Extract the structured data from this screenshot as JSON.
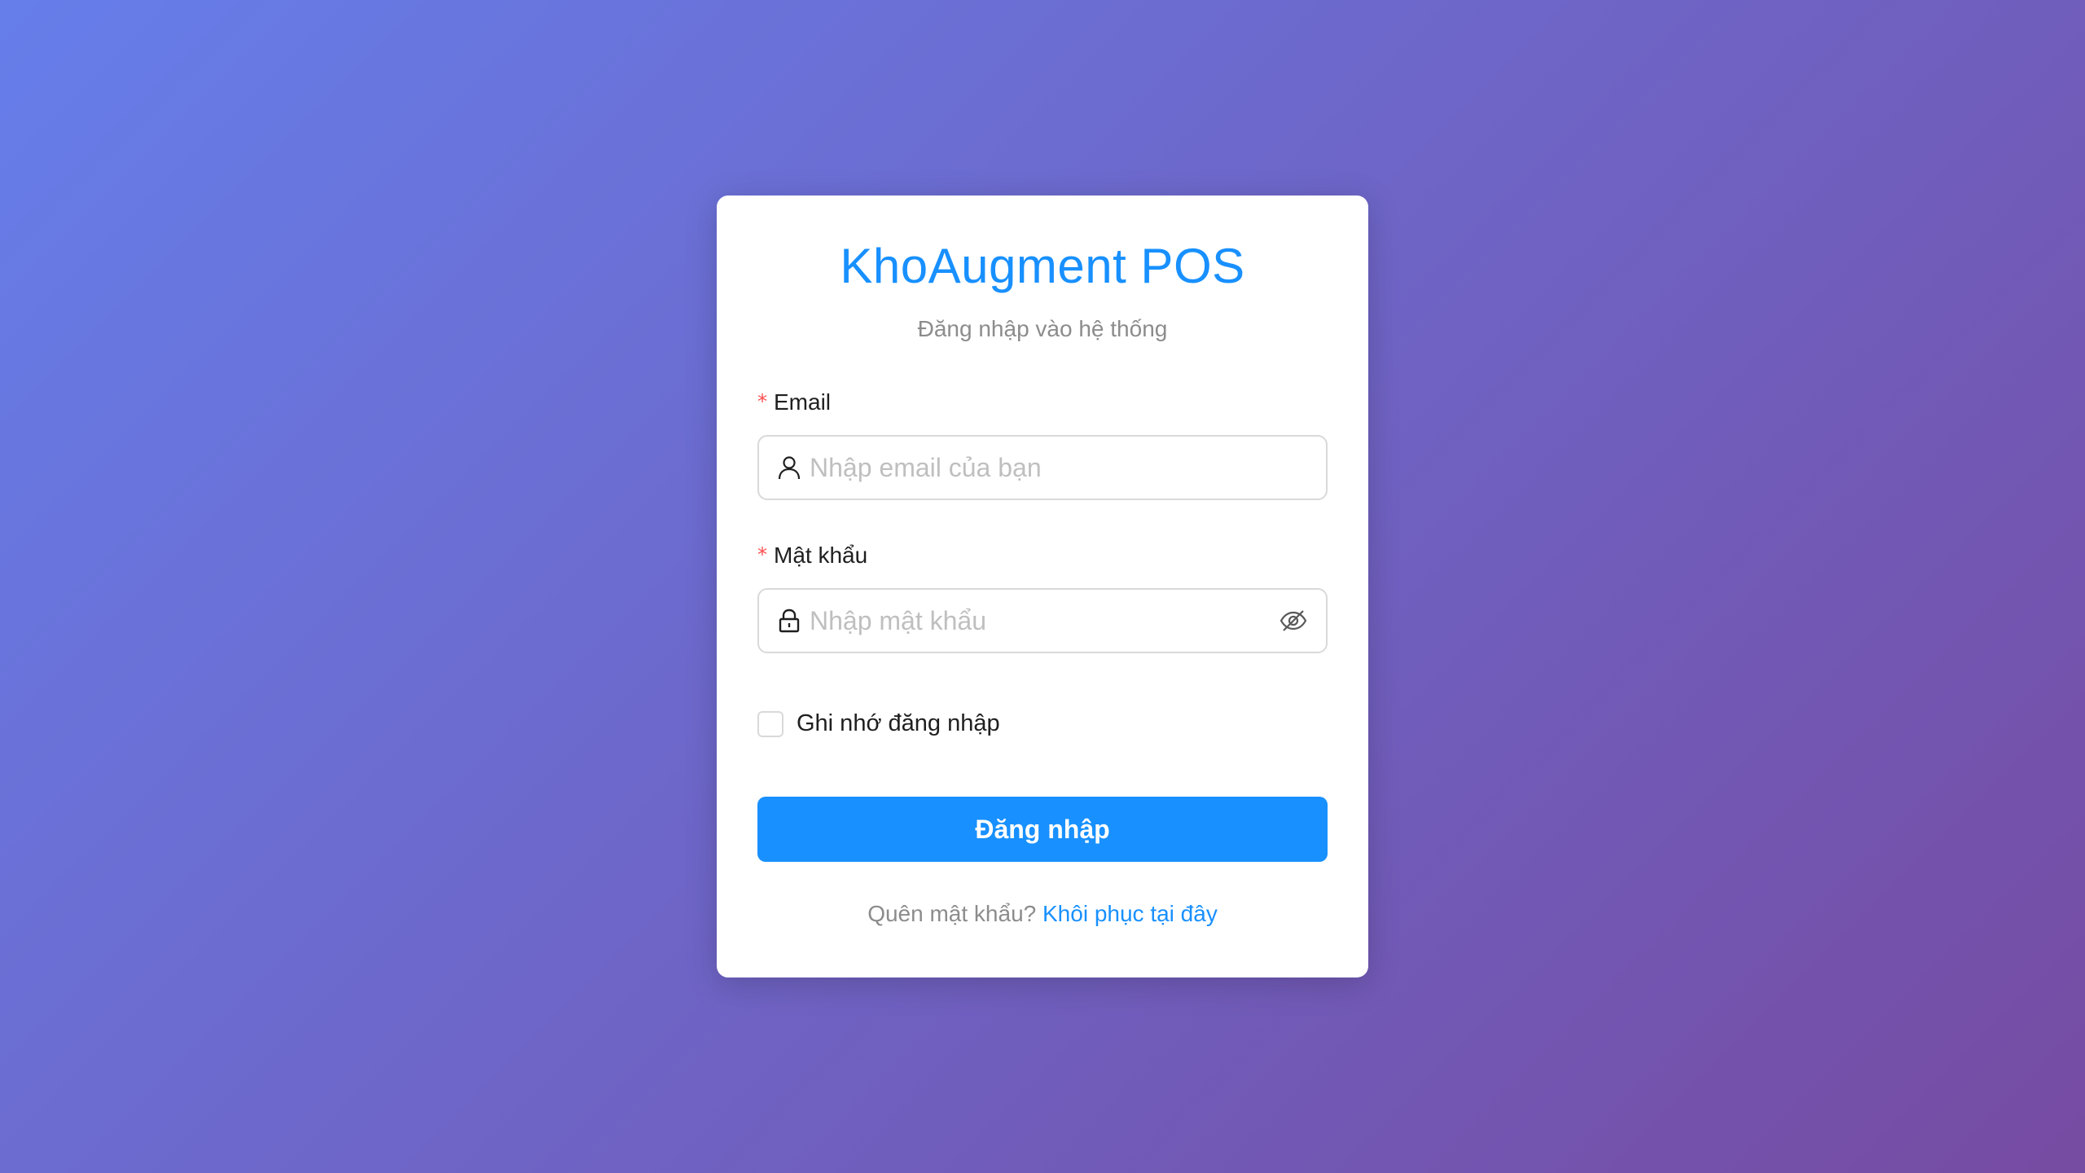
{
  "app": {
    "title": "KhoAugment POS",
    "subtitle": "Đăng nhập vào hệ thống"
  },
  "form": {
    "email": {
      "label": "Email",
      "required_mark": "*",
      "placeholder": "Nhập email của bạn",
      "value": "",
      "prefix_icon": "user-icon"
    },
    "password": {
      "label": "Mật khẩu",
      "required_mark": "*",
      "placeholder": "Nhập mật khẩu",
      "value": "",
      "prefix_icon": "lock-icon",
      "suffix_icon": "eye-off-icon"
    },
    "remember": {
      "label": "Ghi nhớ đăng nhập",
      "checked": false
    },
    "submit_label": "Đăng nhập"
  },
  "footer": {
    "forgot_text": "Quên mật khẩu?",
    "recover_link": "Khôi phục tại đây"
  },
  "colors": {
    "primary": "#1890ff",
    "gradient_start": "#667eea",
    "gradient_end": "#764ba2",
    "required": "#ff4d4f"
  }
}
